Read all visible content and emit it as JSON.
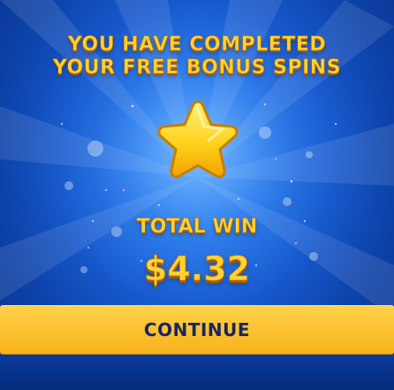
{
  "screen": {
    "title_line_1": "YOU HAVE COMPLETED",
    "title_line_2": "YOUR FREE BONUS SPINS",
    "icon": "star-icon",
    "total_win_label": "TOTAL WIN",
    "total_win_amount": "$4.32",
    "continue_label": "CONTINUE"
  },
  "colors": {
    "background": "#1658cc",
    "title_gold": "#ffd233",
    "button_gold": "#f7b21a",
    "button_text": "#1c2560"
  }
}
